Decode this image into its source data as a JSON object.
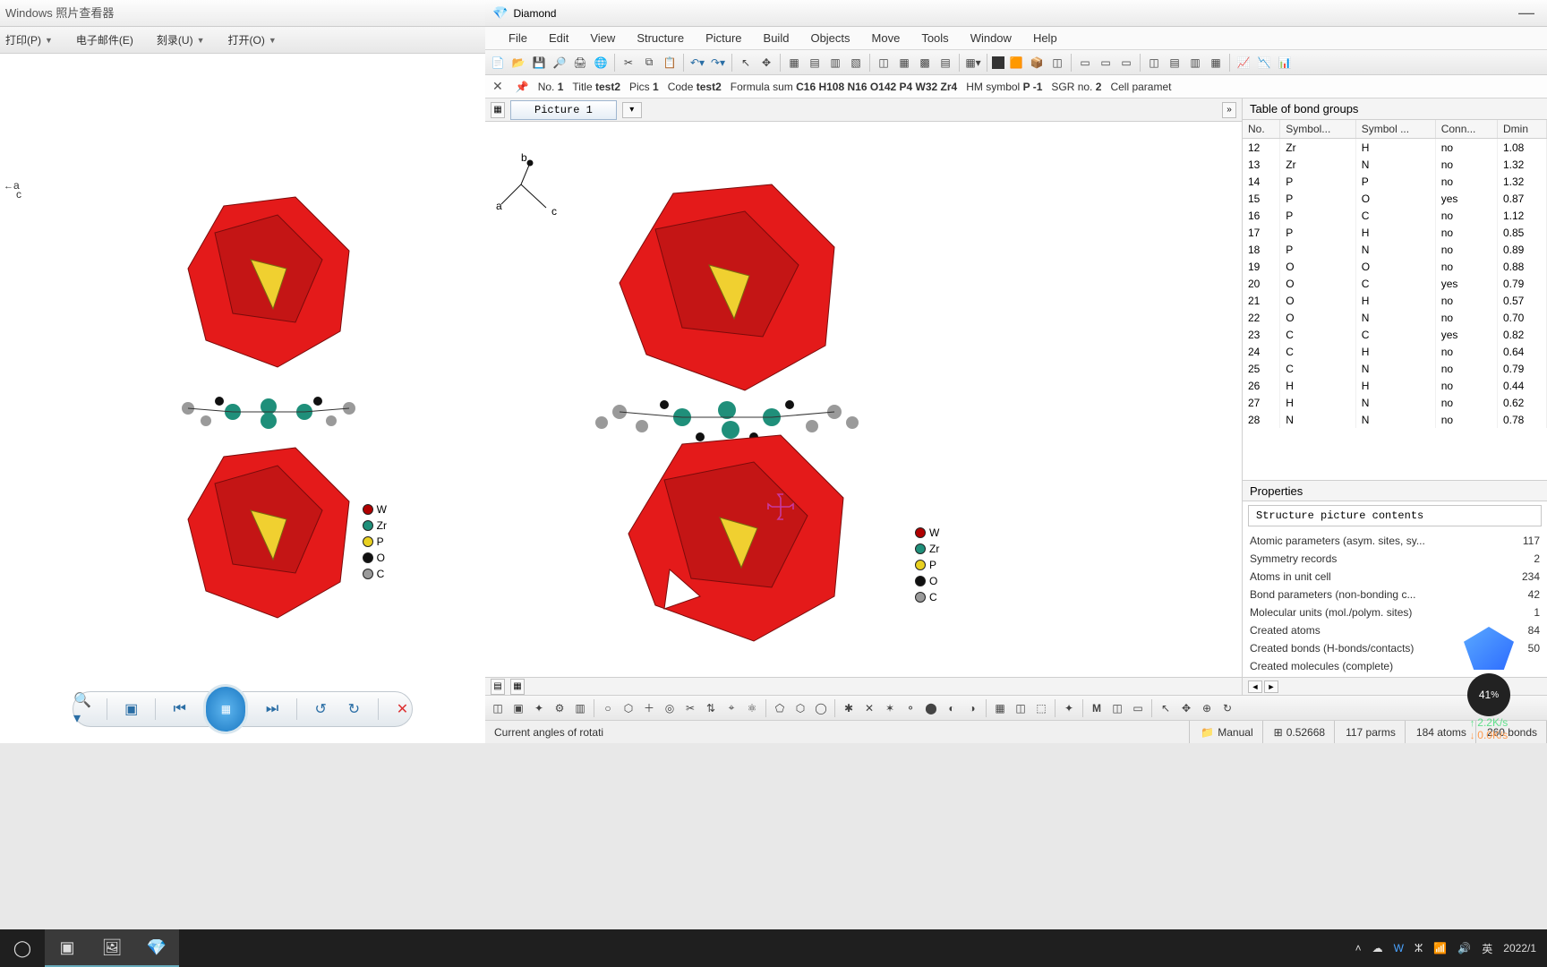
{
  "pv": {
    "title": "Windows 照片查看器",
    "menu": {
      "print": "打印(P)",
      "email": "电子邮件(E)",
      "burn": "刻录(U)",
      "open": "打开(O)"
    },
    "axes": {
      "a": "a",
      "c": "c"
    },
    "legend": [
      {
        "el": "W",
        "color": "#b00000"
      },
      {
        "el": "Zr",
        "color": "#1f8f7a"
      },
      {
        "el": "P",
        "color": "#e8d020"
      },
      {
        "el": "O",
        "color": "#101010"
      },
      {
        "el": "C",
        "color": "#9a9a9a"
      }
    ]
  },
  "dm": {
    "title": "Diamond",
    "menu": [
      "File",
      "Edit",
      "View",
      "Structure",
      "Picture",
      "Build",
      "Objects",
      "Move",
      "Tools",
      "Window",
      "Help"
    ],
    "infobar": {
      "no_label": "No.",
      "no_val": "1",
      "title_label": "Title",
      "title_val": "test2",
      "pics_label": "Pics",
      "pics_val": "1",
      "code_label": "Code",
      "code_val": "test2",
      "formula_label": "Formula sum",
      "formula_val": "C16 H108 N16 O142 P4 W32 Zr4",
      "hm_label": "HM symbol",
      "hm_val": "P -1",
      "sgr_label": "SGR no.",
      "sgr_val": "2",
      "cell_label": "Cell paramet"
    },
    "tab_label": "Picture 1",
    "axes": {
      "a": "a",
      "b": "b",
      "c": "c"
    },
    "legend": [
      {
        "el": "W",
        "color": "#b00000"
      },
      {
        "el": "Zr",
        "color": "#1f8f7a"
      },
      {
        "el": "P",
        "color": "#e8d020"
      },
      {
        "el": "O",
        "color": "#101010"
      },
      {
        "el": "C",
        "color": "#9a9a9a"
      }
    ],
    "bond_table": {
      "title": "Table of bond groups",
      "cols": [
        "No.",
        "Symbol...",
        "Symbol ...",
        "Conn...",
        "Dmin"
      ],
      "rows": [
        {
          "n": "12",
          "s1": "Zr",
          "s2": "H",
          "c": "no",
          "d": "1.08"
        },
        {
          "n": "13",
          "s1": "Zr",
          "s2": "N",
          "c": "no",
          "d": "1.32"
        },
        {
          "n": "14",
          "s1": "P",
          "s2": "P",
          "c": "no",
          "d": "1.32"
        },
        {
          "n": "15",
          "s1": "P",
          "s2": "O",
          "c": "yes",
          "d": "0.87"
        },
        {
          "n": "16",
          "s1": "P",
          "s2": "C",
          "c": "no",
          "d": "1.12"
        },
        {
          "n": "17",
          "s1": "P",
          "s2": "H",
          "c": "no",
          "d": "0.85"
        },
        {
          "n": "18",
          "s1": "P",
          "s2": "N",
          "c": "no",
          "d": "0.89"
        },
        {
          "n": "19",
          "s1": "O",
          "s2": "O",
          "c": "no",
          "d": "0.88"
        },
        {
          "n": "20",
          "s1": "O",
          "s2": "C",
          "c": "yes",
          "d": "0.79"
        },
        {
          "n": "21",
          "s1": "O",
          "s2": "H",
          "c": "no",
          "d": "0.57"
        },
        {
          "n": "22",
          "s1": "O",
          "s2": "N",
          "c": "no",
          "d": "0.70"
        },
        {
          "n": "23",
          "s1": "C",
          "s2": "C",
          "c": "yes",
          "d": "0.82"
        },
        {
          "n": "24",
          "s1": "C",
          "s2": "H",
          "c": "no",
          "d": "0.64"
        },
        {
          "n": "25",
          "s1": "C",
          "s2": "N",
          "c": "no",
          "d": "0.79"
        },
        {
          "n": "26",
          "s1": "H",
          "s2": "H",
          "c": "no",
          "d": "0.44"
        },
        {
          "n": "27",
          "s1": "H",
          "s2": "N",
          "c": "no",
          "d": "0.62"
        },
        {
          "n": "28",
          "s1": "N",
          "s2": "N",
          "c": "no",
          "d": "0.78"
        }
      ]
    },
    "props": {
      "title": "Properties",
      "sub": "Structure picture contents",
      "rows": [
        {
          "k": "Atomic parameters (asym. sites, sy...",
          "v": "117"
        },
        {
          "k": "Symmetry records",
          "v": "2"
        },
        {
          "k": "Atoms in unit cell",
          "v": "234"
        },
        {
          "k": "Bond parameters (non-bonding c...",
          "v": "42"
        },
        {
          "k": "Molecular units (mol./polym. sites)",
          "v": "1"
        },
        {
          "k": "Created atoms",
          "v": "84"
        },
        {
          "k": "Created bonds (H-bonds/contacts)",
          "v": "50"
        },
        {
          "k": "Created molecules (complete)",
          "v": ""
        }
      ]
    },
    "status": {
      "rot": "Current angles of rotati",
      "mode": "Manual",
      "val": "0.52668",
      "parms": "117 parms",
      "atoms": "184 atoms",
      "bonds": "260 bonds"
    }
  },
  "overlay": {
    "pct": "41",
    "unit": "%",
    "up": "2.2K/s",
    "dn": "0.0K/s"
  },
  "tray": {
    "ime": "英",
    "date": "2022/1"
  }
}
